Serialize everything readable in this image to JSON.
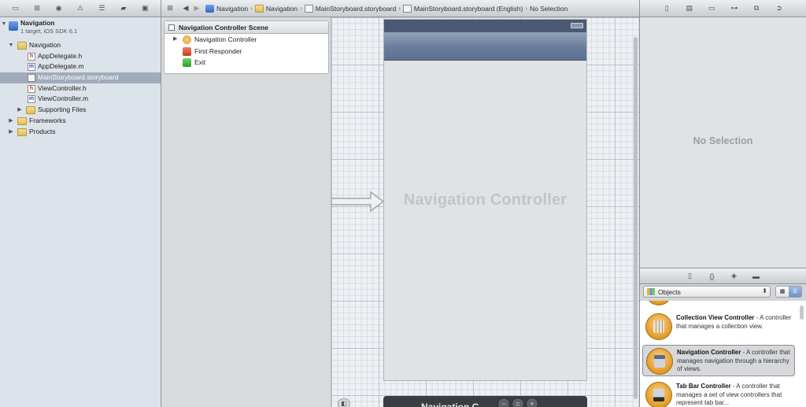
{
  "navigator": {
    "project_name": "Navigation",
    "project_subtitle": "1 target, iOS SDK 6.1",
    "items": [
      {
        "label": "Navigation",
        "kind": "folder",
        "expanded": true
      },
      {
        "label": "AppDelegate.h",
        "kind": "h"
      },
      {
        "label": "AppDelegate.m",
        "kind": "m"
      },
      {
        "label": "MainStoryboard.storyboard",
        "kind": "storyboard",
        "selected": true
      },
      {
        "label": "ViewController.h",
        "kind": "h"
      },
      {
        "label": "ViewController.m",
        "kind": "m"
      },
      {
        "label": "Supporting Files",
        "kind": "folder",
        "expanded": false
      },
      {
        "label": "Frameworks",
        "kind": "folder",
        "expanded": false
      },
      {
        "label": "Products",
        "kind": "folder",
        "expanded": false
      }
    ]
  },
  "jumpbar": {
    "crumbs": [
      "Navigation",
      "Navigation",
      "MainStoryboard.storyboard",
      "MainStoryboard.storyboard (English)",
      "No Selection"
    ]
  },
  "outline": {
    "scene_title": "Navigation Controller Scene",
    "items": [
      "Navigation Controller",
      "First Responder",
      "Exit"
    ]
  },
  "canvas": {
    "device_title": "Navigation Controller",
    "scene_bar_text": "Navigation C"
  },
  "inspector": {
    "empty_text": "No Selection"
  },
  "library": {
    "selector_label": "Objects",
    "items": [
      {
        "name": "Collection View Controller",
        "desc": " - A controller that manages a collection view."
      },
      {
        "name": "Navigation Controller",
        "desc": " - A controller that manages navigation through a hierarchy of views.",
        "selected": true
      },
      {
        "name": "Tab Bar Controller",
        "desc": " - A controller that manages a set of view controllers that represent tab bar..."
      }
    ]
  },
  "colors": {
    "selection": "#a0acbb",
    "nav_bar": "#6c7f9d",
    "status_bar": "#4a5a72",
    "library_icon": "#e49a22"
  }
}
